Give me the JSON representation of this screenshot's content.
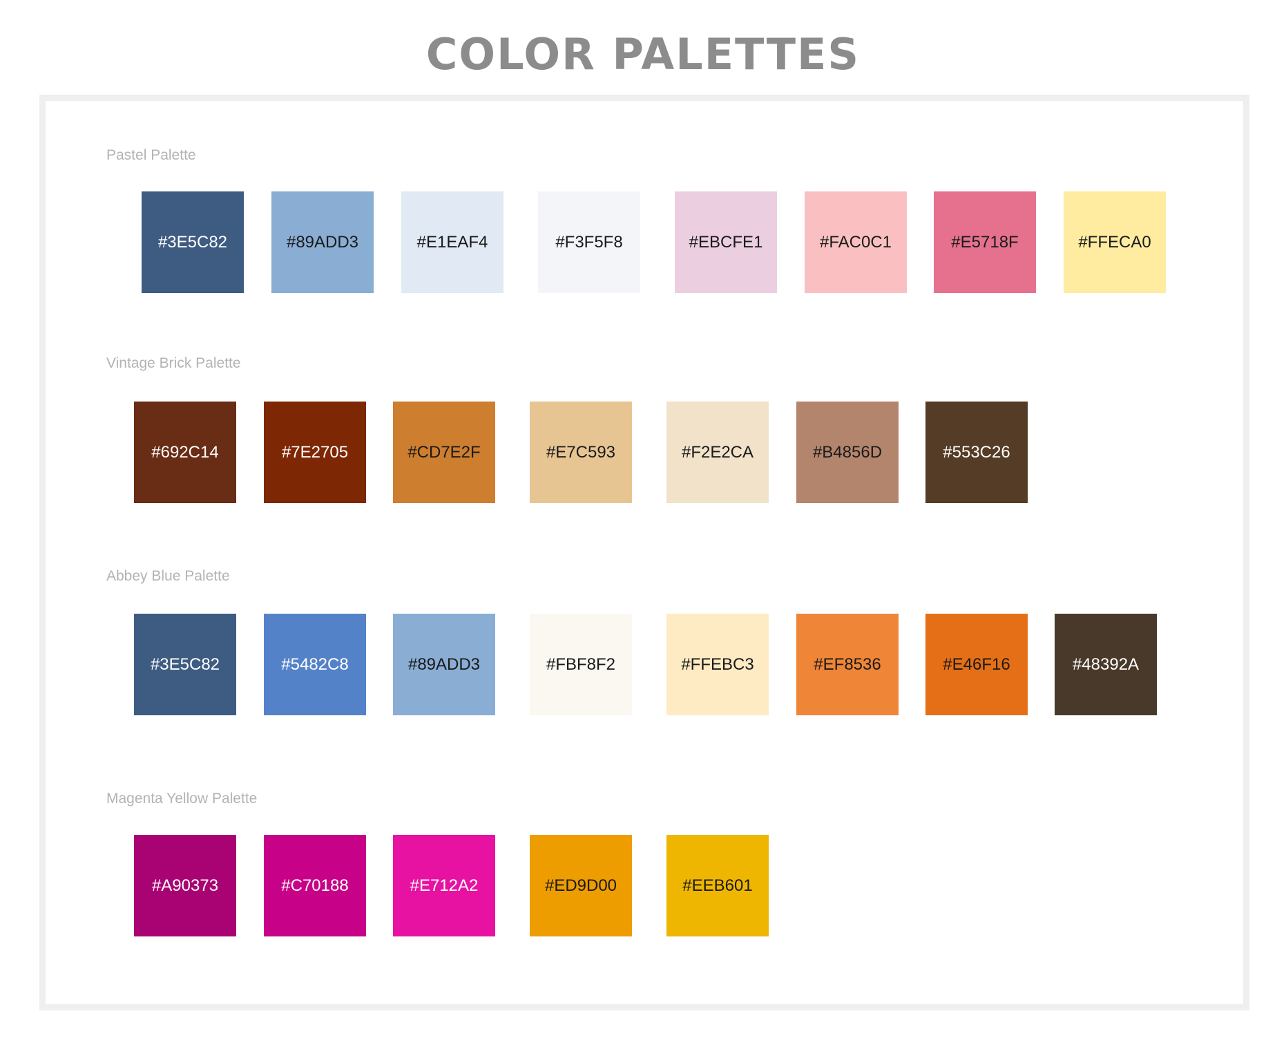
{
  "title": "COLOR PALETTES",
  "palettes": [
    {
      "name": "Pastel Palette",
      "swatches": [
        {
          "hex": "#3E5C82",
          "label": "#3E5C82",
          "text_color": "#ffffff"
        },
        {
          "hex": "#89ADD3",
          "label": "#89ADD3",
          "text_color": "#1a1a1a"
        },
        {
          "hex": "#E1EAF4",
          "label": "#E1EAF4",
          "text_color": "#1a1a1a"
        },
        {
          "hex": "#F3F5F8",
          "label": "#F3F5F8",
          "text_color": "#1a1a1a"
        },
        {
          "hex": "#EBCFE1",
          "label": "#EBCFE1",
          "text_color": "#1a1a1a"
        },
        {
          "hex": "#FAC0C1",
          "label": "#FAC0C1",
          "text_color": "#1a1a1a"
        },
        {
          "hex": "#E5718F",
          "label": "#E5718F",
          "text_color": "#1a1a1a"
        },
        {
          "hex": "#FFECA0",
          "label": "#FFECA0",
          "text_color": "#1a1a1a"
        }
      ]
    },
    {
      "name": "Vintage Brick Palette",
      "swatches": [
        {
          "hex": "#692C14",
          "label": "#692C14",
          "text_color": "#ffffff"
        },
        {
          "hex": "#7E2705",
          "label": "#7E2705",
          "text_color": "#ffffff"
        },
        {
          "hex": "#CD7E2F",
          "label": "#CD7E2F",
          "text_color": "#1a1a1a"
        },
        {
          "hex": "#E7C593",
          "label": "#E7C593",
          "text_color": "#1a1a1a"
        },
        {
          "hex": "#F2E2CA",
          "label": "#F2E2CA",
          "text_color": "#1a1a1a"
        },
        {
          "hex": "#B4856D",
          "label": "#B4856D",
          "text_color": "#1a1a1a"
        },
        {
          "hex": "#553C26",
          "label": "#553C26",
          "text_color": "#ffffff"
        }
      ]
    },
    {
      "name": "Abbey Blue Palette",
      "swatches": [
        {
          "hex": "#3E5C82",
          "label": "#3E5C82",
          "text_color": "#ffffff"
        },
        {
          "hex": "#5482C8",
          "label": "#5482C8",
          "text_color": "#ffffff"
        },
        {
          "hex": "#89ADD3",
          "label": "#89ADD3",
          "text_color": "#1a1a1a"
        },
        {
          "hex": "#FBF8F2",
          "label": "#FBF8F2",
          "text_color": "#1a1a1a"
        },
        {
          "hex": "#FFEBC3",
          "label": "#FFEBC3",
          "text_color": "#1a1a1a"
        },
        {
          "hex": "#EF8536",
          "label": "#EF8536",
          "text_color": "#1a1a1a"
        },
        {
          "hex": "#E46F16",
          "label": "#E46F16",
          "text_color": "#1a1a1a"
        },
        {
          "hex": "#48392A",
          "label": "#48392A",
          "text_color": "#ffffff"
        }
      ]
    },
    {
      "name": "Magenta Yellow Palette",
      "swatches": [
        {
          "hex": "#A90373",
          "label": "#A90373",
          "text_color": "#ffffff"
        },
        {
          "hex": "#C70188",
          "label": "#C70188",
          "text_color": "#ffffff"
        },
        {
          "hex": "#E712A2",
          "label": "#E712A2",
          "text_color": "#ffffff"
        },
        {
          "hex": "#ED9D00",
          "label": "#ED9D00",
          "text_color": "#1a1a1a"
        },
        {
          "hex": "#EEB601",
          "label": "#EEB601",
          "text_color": "#1a1a1a"
        }
      ]
    }
  ]
}
